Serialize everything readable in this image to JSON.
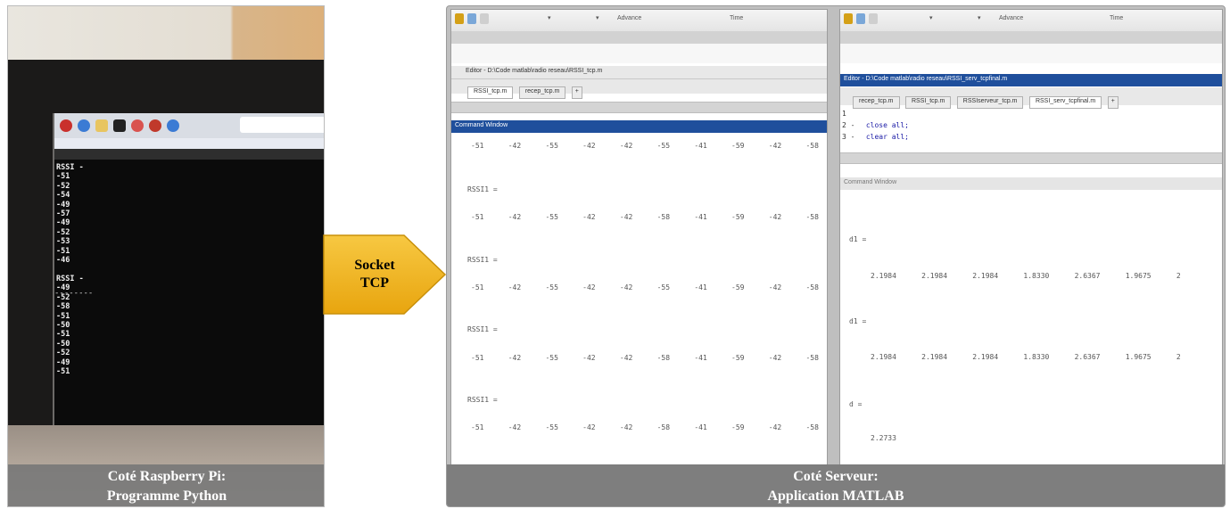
{
  "left_panel": {
    "pi_output": "RSSI -\n-51\n-52\n-54\n-49\n-57\n-49\n-52\n-53\n-51\n-46\n\nRSSI -\n-49\n-52\n-58\n-51\n-50\n-51\n-50\n-52\n-49\n-51",
    "separator": "--------",
    "caption_line1": "Coté Raspberry Pi:",
    "caption_line2": "Programme Python"
  },
  "arrow": {
    "line1": "Socket",
    "line2": "TCP",
    "color": "#f2b51c"
  },
  "matlab_left": {
    "ribbon_item1": "Advance",
    "ribbon_item2": "Time",
    "editor_title": "Editor - D:\\Code matlab\\radio reseau\\RSSI_tcp.m",
    "tabs": [
      "RSSI_tcp.m",
      "recep_tcp.m"
    ],
    "command_window_label": "Command Window",
    "first_row": [
      "-51",
      "-42",
      "-55",
      "-42",
      "-42",
      "-55",
      "-41",
      "-59",
      "-42",
      "-58"
    ],
    "blocks": [
      {
        "label": "RSSI1 =",
        "values": [
          "-51",
          "-42",
          "-55",
          "-42",
          "-42",
          "-58",
          "-41",
          "-59",
          "-42",
          "-58"
        ]
      },
      {
        "label": "RSSI1 =",
        "values": [
          "-51",
          "-42",
          "-55",
          "-42",
          "-42",
          "-55",
          "-41",
          "-59",
          "-42",
          "-58"
        ]
      },
      {
        "label": "RSSI1 =",
        "values": [
          "-51",
          "-42",
          "-55",
          "-42",
          "-42",
          "-58",
          "-41",
          "-59",
          "-42",
          "-58"
        ]
      },
      {
        "label": "RSSI1 =",
        "values": [
          "-51",
          "-42",
          "-55",
          "-42",
          "-42",
          "-58",
          "-41",
          "-59",
          "-42",
          "-58"
        ]
      }
    ]
  },
  "matlab_right": {
    "ribbon_item1": "Advance",
    "ribbon_item2": "Time",
    "editor_title": "Editor - D:\\Code matlab\\radio reseau\\RSSI_serv_tcpfinal.m",
    "tabs": [
      "recep_tcp.m",
      "RSSI_tcp.m",
      "RSSIserveur_tcp.m",
      "RSSI_serv_tcpfinal.m"
    ],
    "plus": "+",
    "code_lines": [
      {
        "num": "1",
        "text": ""
      },
      {
        "num": "2 -",
        "text": "close all;"
      },
      {
        "num": "3 -",
        "text": "clear all;"
      }
    ],
    "command_window_label": "Command Window",
    "d1_label": "d1 =",
    "d1_values": [
      "2.1984",
      "2.1984",
      "2.1984",
      "1.8330",
      "2.6367",
      "1.9675",
      "2"
    ],
    "d1b_label": "d1 =",
    "d1b_values": [
      "2.1984",
      "2.1984",
      "2.1984",
      "1.8330",
      "2.6367",
      "1.9675",
      "2"
    ],
    "d_label": "d =",
    "d_value": "2.2733"
  },
  "right_caption": {
    "line1": "Coté Serveur:",
    "line2": "Application MATLAB"
  }
}
